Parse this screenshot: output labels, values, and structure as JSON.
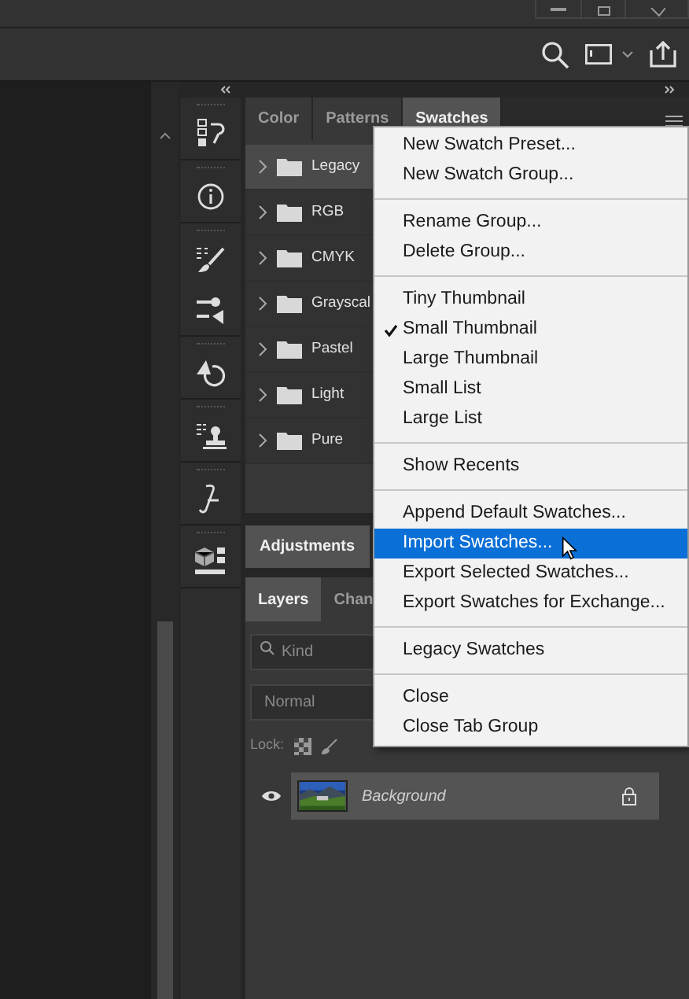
{
  "swatches_panel": {
    "tabs": [
      {
        "label": "Color",
        "selected": false
      },
      {
        "label": "Patterns",
        "selected": false
      },
      {
        "label": "Swatches",
        "selected": true
      }
    ],
    "groups": [
      {
        "name": "Legacy",
        "selected": true
      },
      {
        "name": "RGB",
        "selected": false
      },
      {
        "name": "CMYK",
        "selected": false
      },
      {
        "name": "Grayscal",
        "selected": false
      },
      {
        "name": "Pastel",
        "selected": false
      },
      {
        "name": "Light",
        "selected": false
      },
      {
        "name": "Pure",
        "selected": false
      }
    ]
  },
  "adjustments_panel": {
    "tabs": [
      {
        "label": "Adjustments",
        "selected": true
      }
    ]
  },
  "layers_panel": {
    "tabs": [
      {
        "label": "Layers",
        "selected": true
      },
      {
        "label": "Chan",
        "selected": false
      }
    ],
    "filter": {
      "placeholder": "Kind"
    },
    "blend_mode": "Normal",
    "lock_label": "Lock:",
    "layers": [
      {
        "name": "Background",
        "visible": true,
        "locked": true,
        "selected": true
      }
    ]
  },
  "panel_menu": {
    "sections": [
      [
        {
          "label": "New Swatch Preset...",
          "checked": false,
          "selected": false
        },
        {
          "label": "New Swatch Group...",
          "checked": false,
          "selected": false
        }
      ],
      [
        {
          "label": "Rename Group...",
          "checked": false,
          "selected": false
        },
        {
          "label": "Delete Group...",
          "checked": false,
          "selected": false
        }
      ],
      [
        {
          "label": "Tiny Thumbnail",
          "checked": false,
          "selected": false
        },
        {
          "label": "Small Thumbnail",
          "checked": true,
          "selected": false
        },
        {
          "label": "Large Thumbnail",
          "checked": false,
          "selected": false
        },
        {
          "label": "Small List",
          "checked": false,
          "selected": false
        },
        {
          "label": "Large List",
          "checked": false,
          "selected": false
        }
      ],
      [
        {
          "label": "Show Recents",
          "checked": false,
          "selected": false
        }
      ],
      [
        {
          "label": "Append Default Swatches...",
          "checked": false,
          "selected": false
        },
        {
          "label": "Import Swatches...",
          "checked": false,
          "selected": true
        },
        {
          "label": "Export Selected Swatches...",
          "checked": false,
          "selected": false
        },
        {
          "label": "Export Swatches for Exchange...",
          "checked": false,
          "selected": false
        }
      ],
      [
        {
          "label": "Legacy Swatches",
          "checked": false,
          "selected": false
        }
      ],
      [
        {
          "label": "Close",
          "checked": false,
          "selected": false
        },
        {
          "label": "Close Tab Group",
          "checked": false,
          "selected": false
        }
      ]
    ]
  }
}
